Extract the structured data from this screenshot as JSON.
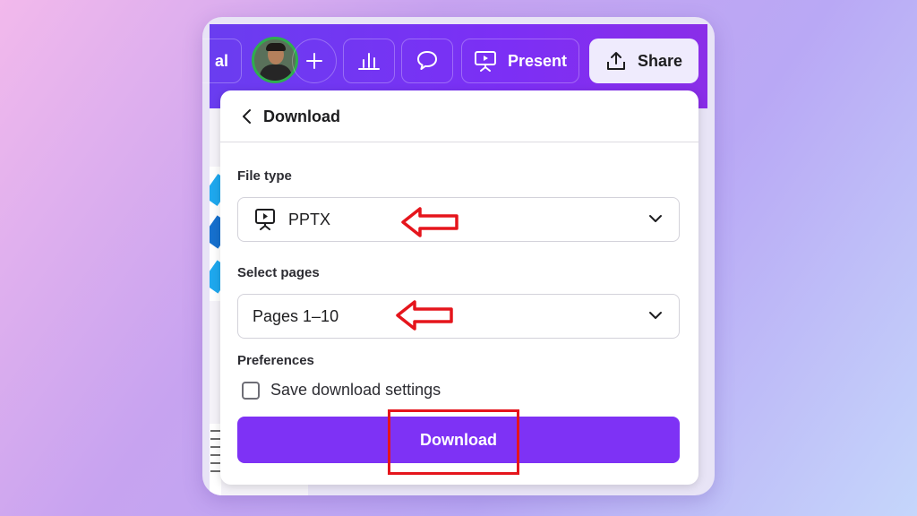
{
  "topbar": {
    "trial_fragment": "al",
    "present_label": "Present",
    "share_label": "Share"
  },
  "download_panel": {
    "title": "Download",
    "file_type": {
      "label": "File type",
      "value": "PPTX"
    },
    "pages": {
      "label": "Select pages",
      "value": "Pages 1–10"
    },
    "preferences": {
      "label": "Preferences",
      "checkbox_label": "Save download settings",
      "checked": false
    },
    "download_button": "Download"
  },
  "colors": {
    "topbar": "#7c2ff5",
    "download_button": "#7e32f5",
    "annotation": "#e5151c"
  }
}
